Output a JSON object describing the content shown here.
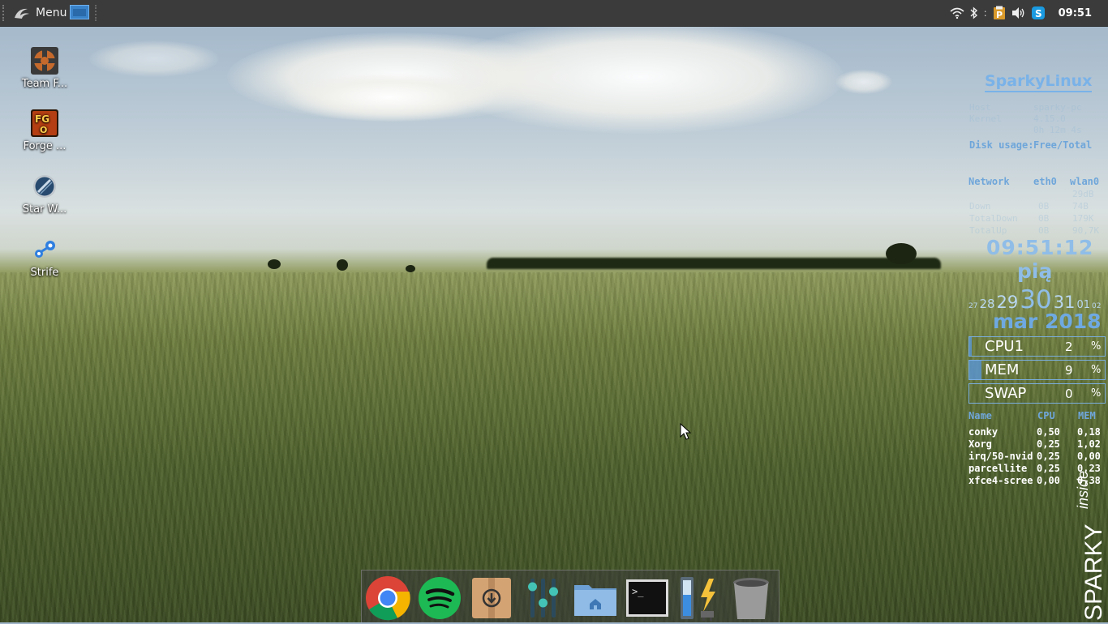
{
  "panel": {
    "menu_label": "Menu",
    "clock": "09:51",
    "tray_icons": [
      "wifi-icon",
      "bluetooth-icon",
      "parcellite-icon",
      "volume-icon",
      "skype-icon"
    ]
  },
  "desktop_icons": [
    {
      "label": "Team F...",
      "icon": "team-fortress-icon"
    },
    {
      "label": "Forge ...",
      "icon": "forge-icon"
    },
    {
      "label": "Star W...",
      "icon": "star-wars-icon"
    },
    {
      "label": "Strife",
      "icon": "strife-icon"
    }
  ],
  "conky": {
    "title": "SparkyLinux",
    "host_label": "Host",
    "host_value": "sparky-pc",
    "kernel_label": "Kernel",
    "kernel_value": "4.15.0",
    "uptime_value": "0h 12m 4s",
    "disk_usage_label": "Disk usage:",
    "disk_usage_value": "Free/Total",
    "network_label": "Network",
    "net_if1": "eth0",
    "net_if2": "wlan0",
    "net_rows": [
      {
        "label": "",
        "eth0": "",
        "wlan0": "29dB"
      },
      {
        "label": "Down",
        "eth0": "0B",
        "wlan0": "74B"
      },
      {
        "label": "TotalDown",
        "eth0": "0B",
        "wlan0": "179K"
      },
      {
        "label": "TotalUp",
        "eth0": "0B",
        "wlan0": "90,7K"
      }
    ],
    "time": "09:51:12",
    "weekday": "pią",
    "calendar": [
      "27",
      "28",
      "29",
      "30",
      "31",
      "01",
      "02"
    ],
    "month_year": "mar 2018",
    "bars": [
      {
        "name": "CPU1",
        "value": "2",
        "unit": "%",
        "level": 0.02
      },
      {
        "name": "MEM",
        "value": "9",
        "unit": "%",
        "level": 0.09
      },
      {
        "name": "SWAP",
        "value": "0",
        "unit": "%",
        "level": 0.0
      }
    ],
    "proc_headers": {
      "name": "Name",
      "cpu": "CPU",
      "mem": "MEM"
    },
    "processes": [
      {
        "name": "conky",
        "cpu": "0,50",
        "mem": "0,18"
      },
      {
        "name": "Xorg",
        "cpu": "0,25",
        "mem": "1,02"
      },
      {
        "name": "irq/50-nvid",
        "cpu": "0,25",
        "mem": "0,00"
      },
      {
        "name": "parcellite",
        "cpu": "0,25",
        "mem": "0,23"
      },
      {
        "name": "xfce4-scree",
        "cpu": "0,00",
        "mem": "0,38"
      }
    ],
    "watermark_main": "SPARKY",
    "watermark_sub": "inside"
  },
  "dock": {
    "items": [
      "chrome-icon",
      "spotify-icon",
      "archive-manager-icon",
      "mixer-icon",
      "home-folder-icon",
      "terminal-icon",
      "battery-power-icon",
      "trash-icon"
    ]
  },
  "colors": {
    "panel": "#3b3b3b",
    "conky_accent": "#79b2e8",
    "workspace": "#3b83c9"
  }
}
